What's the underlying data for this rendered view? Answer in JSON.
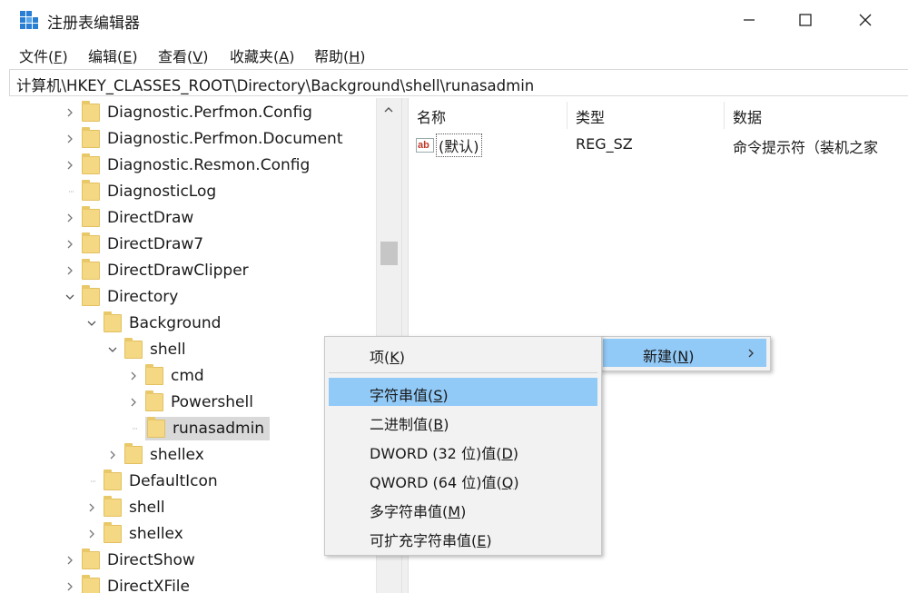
{
  "window": {
    "title": "注册表编辑器",
    "icon": "regedit-icon",
    "controls": [
      "minimize-icon",
      "maximize-icon",
      "close-icon"
    ]
  },
  "menubar": [
    {
      "pre": "文件(",
      "key": "F",
      "post": ")"
    },
    {
      "pre": "编辑(",
      "key": "E",
      "post": ")"
    },
    {
      "pre": "查看(",
      "key": "V",
      "post": ")"
    },
    {
      "pre": "收藏夹(",
      "key": "A",
      "post": ")"
    },
    {
      "pre": "帮助(",
      "key": "H",
      "post": ")"
    }
  ],
  "address": "计算机\\HKEY_CLASSES_ROOT\\Directory\\Background\\shell\\runasadmin",
  "tree": [
    {
      "label": "Diagnostic.Perfmon.Config",
      "expander": "collapsed"
    },
    {
      "label": "Diagnostic.Perfmon.Document",
      "expander": "collapsed"
    },
    {
      "label": "Diagnostic.Resmon.Config",
      "expander": "collapsed"
    },
    {
      "label": "DiagnosticLog",
      "expander": "none"
    },
    {
      "label": "DirectDraw",
      "expander": "collapsed"
    },
    {
      "label": "DirectDraw7",
      "expander": "collapsed"
    },
    {
      "label": "DirectDrawClipper",
      "expander": "collapsed"
    },
    {
      "label": "Directory",
      "expander": "expanded"
    },
    {
      "label": "Background",
      "expander": "expanded"
    },
    {
      "label": "shell",
      "expander": "expanded"
    },
    {
      "label": "cmd",
      "expander": "collapsed"
    },
    {
      "label": "Powershell",
      "expander": "collapsed"
    },
    {
      "label": "runasadmin",
      "expander": "none",
      "selected": true
    },
    {
      "label": "shellex",
      "expander": "collapsed"
    },
    {
      "label": "DefaultIcon",
      "expander": "none"
    },
    {
      "label": "shell",
      "expander": "collapsed"
    },
    {
      "label": "shellex",
      "expander": "collapsed"
    },
    {
      "label": "DirectShow",
      "expander": "collapsed"
    },
    {
      "label": "DirectXFile",
      "expander": "collapsed"
    }
  ],
  "values_pane": {
    "headers": {
      "name": "名称",
      "type": "类型",
      "data": "数据"
    },
    "rows": [
      {
        "name": "(默认)",
        "type": "REG_SZ",
        "data": "命令提示符（装机之家",
        "icon": "string-value-icon"
      }
    ]
  },
  "context_menu": {
    "new_label": "新建(",
    "new_key": "N",
    "new_post": ")",
    "submenu": [
      {
        "pre": "项(",
        "key": "K",
        "post": ")"
      },
      {
        "pre": "字符串值(",
        "key": "S",
        "post": ")",
        "highlighted": true
      },
      {
        "pre": "二进制值(",
        "key": "B",
        "post": ")"
      },
      {
        "pre": "DWORD (32 位)值(",
        "key": "D",
        "post": ")"
      },
      {
        "pre": "QWORD (64 位)值(",
        "key": "Q",
        "post": ")"
      },
      {
        "pre": "多字符串值(",
        "key": "M",
        "post": ")"
      },
      {
        "pre": "可扩充字符串值(",
        "key": "E",
        "post": ")"
      }
    ]
  },
  "colors": {
    "highlight": "#91c9f7",
    "folder": "#f4d884",
    "selection": "#d9d9d9"
  }
}
